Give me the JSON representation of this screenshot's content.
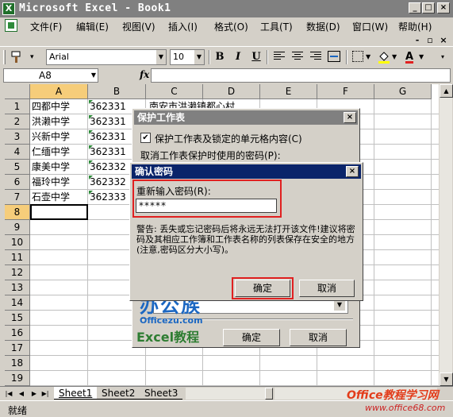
{
  "window": {
    "title": "Microsoft Excel - Book1",
    "app_icon_label": "X",
    "caption_buttons": {
      "minimize": "_",
      "restore": "□",
      "close": "×"
    }
  },
  "menu": {
    "items": [
      {
        "label": "文件(F)"
      },
      {
        "label": "编辑(E)"
      },
      {
        "label": "视图(V)"
      },
      {
        "label": "插入(I)"
      },
      {
        "label": "格式(O)"
      },
      {
        "label": "工具(T)"
      },
      {
        "label": "数据(D)"
      },
      {
        "label": "窗口(W)"
      },
      {
        "label": "帮助(H)"
      }
    ],
    "doc_buttons": {
      "minimize": "-",
      "restore": "▫",
      "close": "×"
    }
  },
  "toolbar": {
    "font_name": "Arial",
    "font_size": "10",
    "bold": "B",
    "italic": "I",
    "underline": "U",
    "font_color_label": "A"
  },
  "formula_bar": {
    "name_box": "A8",
    "fx_label": "fx",
    "formula": ""
  },
  "sheet": {
    "columns": [
      "A",
      "B",
      "C",
      "D",
      "E",
      "F",
      "G"
    ],
    "rows": [
      "1",
      "2",
      "3",
      "4",
      "5",
      "6",
      "7",
      "8",
      "9",
      "10",
      "11",
      "12",
      "13",
      "14",
      "15",
      "16",
      "17",
      "18",
      "19"
    ],
    "col_a": [
      "四都中学",
      "洪濑中学",
      "兴新中学",
      "仁缅中学",
      "康美中学",
      "福玲中学",
      "石壶中学"
    ],
    "col_b": [
      "362331",
      "362331",
      "362331",
      "362331",
      "362332",
      "362332",
      "362333"
    ],
    "c1_text": "南安市洪濑镇都心村",
    "selected_cell": "A8"
  },
  "sheet_tabs": {
    "nav": [
      "|◀",
      "◀",
      "▶",
      "▶|"
    ],
    "tabs": [
      "Sheet1",
      "Sheet2",
      "Sheet3"
    ],
    "active": "Sheet1"
  },
  "status": {
    "text": "就绪"
  },
  "protect_dialog": {
    "title": "保护工作表",
    "checkbox_label": "保护工作表及锁定的单元格内容(C)",
    "checkbox_checked": true,
    "password_label": "取消工作表保护时使用的密码(P):",
    "ok_label": "确定",
    "cancel_label": "取消"
  },
  "confirm_dialog": {
    "title": "确认密码",
    "reenter_label": "重新输入密码(R):",
    "password_value": "*****",
    "warning": "警告: 丢失或忘记密码后将永远无法打开该文件!建议将密码及其相应工作簿和工作表名称的列表保存在安全的地方(注意,密码区分大小写)。",
    "ok_label": "确定",
    "cancel_label": "取消"
  },
  "watermarks": {
    "logo_big": "办公族",
    "logo_small": "Officezu.com",
    "logo_excel": "Excel教程",
    "corner_1": "Office教程学习网",
    "corner_2": "www.office68.com"
  },
  "colors": {
    "title_inactive": "#808080",
    "dialog_title_active": "#0a246a",
    "highlight_red": "#e02020",
    "selected_header": "#f6cd7a",
    "logo_blue": "#1b67c2",
    "logo_green": "#2e7d32"
  }
}
